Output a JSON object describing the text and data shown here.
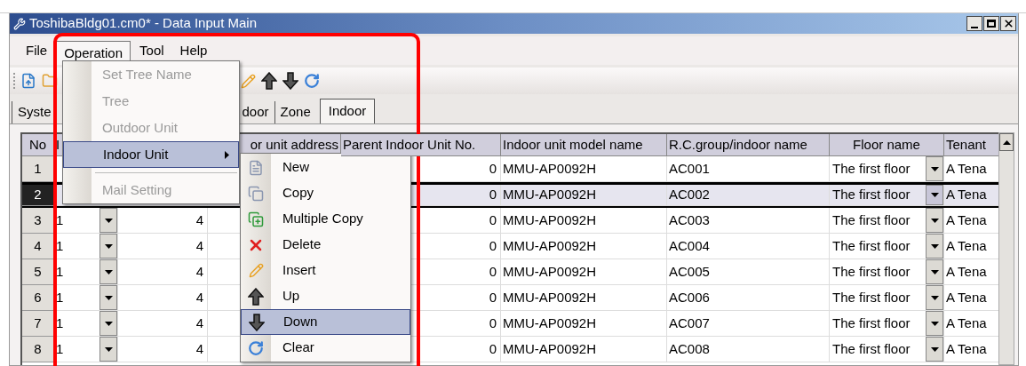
{
  "window": {
    "title": "ToshibaBldg01.cm0* - Data Input Main"
  },
  "menu_bar": [
    {
      "label": "File",
      "selected": false
    },
    {
      "label": "Operation",
      "selected": true
    },
    {
      "label": "Tool",
      "selected": false
    },
    {
      "label": "Help",
      "selected": false
    }
  ],
  "tabs": [
    {
      "label": "Syste",
      "selected": false
    },
    {
      "label": "door",
      "selected": false
    },
    {
      "label": "Zone",
      "selected": false
    },
    {
      "label": "Indoor",
      "selected": true
    }
  ],
  "dropdown_menu": [
    {
      "kind": "item",
      "label": "Set Tree Name",
      "disabled": true,
      "selected": false,
      "has_submenu": false
    },
    {
      "kind": "item",
      "label": "Tree",
      "disabled": true,
      "selected": false,
      "has_submenu": false
    },
    {
      "kind": "item",
      "label": "Outdoor Unit",
      "disabled": true,
      "selected": false,
      "has_submenu": false
    },
    {
      "kind": "item",
      "label": "Indoor Unit",
      "disabled": false,
      "selected": true,
      "has_submenu": true
    },
    {
      "kind": "separator"
    },
    {
      "kind": "item",
      "label": "Mail Setting",
      "disabled": true,
      "selected": false,
      "has_submenu": false
    }
  ],
  "submenu": [
    {
      "label": "New",
      "selected": false
    },
    {
      "label": "Copy",
      "selected": false
    },
    {
      "label": "Multiple Copy",
      "selected": false
    },
    {
      "label": "Delete",
      "selected": false
    },
    {
      "label": "Insert",
      "selected": false
    },
    {
      "label": "Up",
      "selected": false
    },
    {
      "label": "Down",
      "selected": true
    },
    {
      "label": "Clear",
      "selected": false
    }
  ],
  "grid": {
    "columns": [
      "No",
      "I",
      null,
      "or unit address",
      "Parent Indoor Unit No.",
      "Indoor unit model name",
      "R.C.group/indoor name",
      "Floor name",
      "Tenant"
    ],
    "rows": [
      {
        "selected": false,
        "cells": [
          "1",
          null,
          null,
          null,
          "0",
          "MMU-AP0092H",
          "AC001",
          "The first floor",
          "A Tena"
        ]
      },
      {
        "selected": true,
        "cells": [
          "2",
          null,
          null,
          null,
          "0",
          "MMU-AP0092H",
          "AC002",
          "The first floor",
          "A Tena"
        ]
      },
      {
        "selected": false,
        "cells": [
          "3",
          "1",
          "4",
          null,
          "0",
          "MMU-AP0092H",
          "AC003",
          "The first floor",
          "A Tena"
        ]
      },
      {
        "selected": false,
        "cells": [
          "4",
          "1",
          "4",
          null,
          "0",
          "MMU-AP0092H",
          "AC004",
          "The first floor",
          "A Tena"
        ]
      },
      {
        "selected": false,
        "cells": [
          "5",
          "1",
          "4",
          null,
          "0",
          "MMU-AP0092H",
          "AC005",
          "The first floor",
          "A Tena"
        ]
      },
      {
        "selected": false,
        "cells": [
          "6",
          "1",
          "4",
          null,
          "0",
          "MMU-AP0092H",
          "AC006",
          "The first floor",
          "A Tena"
        ]
      },
      {
        "selected": false,
        "cells": [
          "7",
          "1",
          "4",
          null,
          "0",
          "MMU-AP0092H",
          "AC007",
          "The first floor",
          "A Tena"
        ]
      },
      {
        "selected": false,
        "cells": [
          "8",
          "1",
          "4",
          null,
          "0",
          "MMU-AP0092H",
          "AC008",
          "The first floor",
          "A Tena"
        ]
      }
    ]
  }
}
